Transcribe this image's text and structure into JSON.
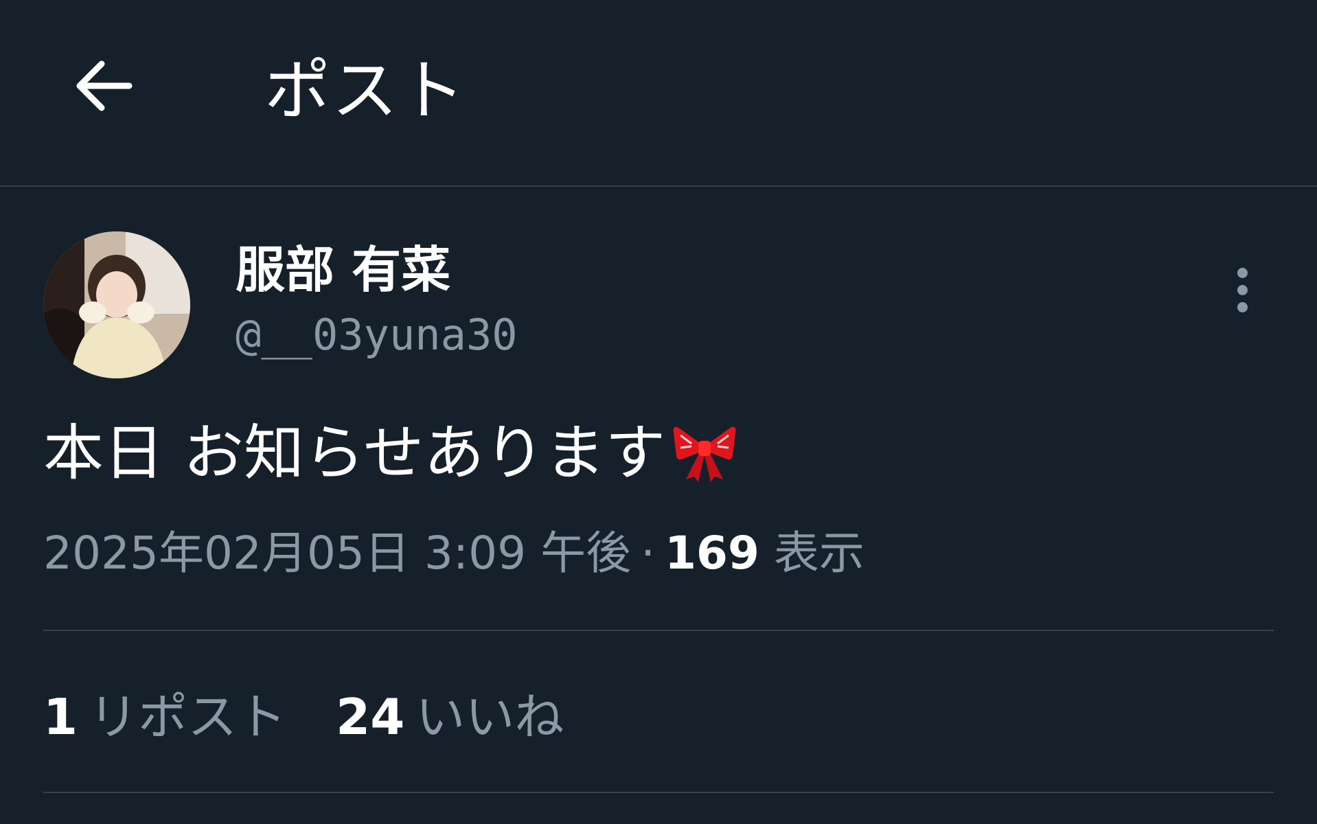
{
  "header": {
    "title": "ポスト",
    "back_icon": "arrow-left-icon"
  },
  "author": {
    "display_name": "服部 有菜",
    "handle": "@__03yuna30",
    "more_icon": "more-vertical-icon"
  },
  "post": {
    "text": "本日 お知らせあります",
    "emoji": "ribbon-bow-icon",
    "timestamp": "2025年02月05日 3:09 午後",
    "separator": "·",
    "views_count": "169",
    "views_label": "表示"
  },
  "stats": {
    "reposts_count": "1",
    "reposts_label": "リポスト",
    "likes_count": "24",
    "likes_label": "いいね"
  },
  "colors": {
    "background": "#15202b",
    "secondary_text": "#8b98a5",
    "divider": "#38444d",
    "bow": "#e0161e"
  }
}
